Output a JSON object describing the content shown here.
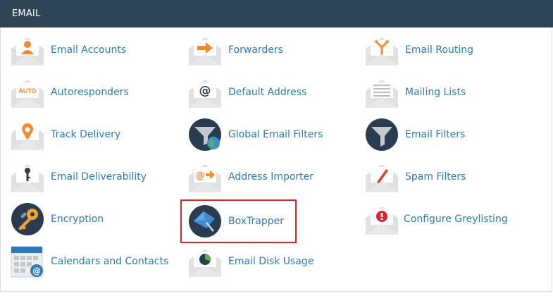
{
  "section": {
    "title": "EMAIL"
  },
  "items": [
    {
      "label": "Email Accounts",
      "icon": "person-envelope-icon"
    },
    {
      "label": "Forwarders",
      "icon": "forward-arrow-envelope-icon"
    },
    {
      "label": "Email Routing",
      "icon": "routing-arrows-envelope-icon"
    },
    {
      "label": "Autoresponders",
      "icon": "auto-envelope-icon"
    },
    {
      "label": "Default Address",
      "icon": "at-envelope-icon"
    },
    {
      "label": "Mailing Lists",
      "icon": "list-envelope-icon"
    },
    {
      "label": "Track Delivery",
      "icon": "location-pin-envelope-icon"
    },
    {
      "label": "Global Email Filters",
      "icon": "funnel-globe-icon"
    },
    {
      "label": "Email Filters",
      "icon": "funnel-icon"
    },
    {
      "label": "Email Deliverability",
      "icon": "key-envelope-icon"
    },
    {
      "label": "Address Importer",
      "icon": "at-arrow-envelope-icon"
    },
    {
      "label": "Spam Filters",
      "icon": "pen-envelope-icon"
    },
    {
      "label": "Encryption",
      "icon": "keys-icon"
    },
    {
      "label": "BoxTrapper",
      "icon": "boxtrapper-icon"
    },
    {
      "label": "Configure Greylisting",
      "icon": "alert-envelope-icon"
    },
    {
      "label": "Calendars and Contacts",
      "icon": "calendar-icon"
    },
    {
      "label": "Email Disk Usage",
      "icon": "pie-chart-envelope-icon"
    }
  ],
  "highlighted_item": "BoxTrapper",
  "colors": {
    "header_bg": "#2f4454",
    "link": "#2e7ab8",
    "highlight_border": "#d9262c",
    "icon_dark": "#2b3c50",
    "icon_orange": "#f28a2e"
  }
}
